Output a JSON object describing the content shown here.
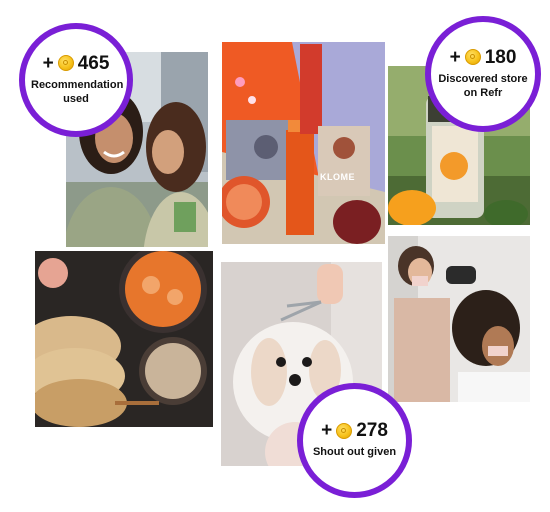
{
  "badges": [
    {
      "sign": "+",
      "points": "465",
      "caption": "Recommendation used"
    },
    {
      "sign": "+",
      "points": "180",
      "caption": "Discovered store on Refr"
    },
    {
      "sign": "+",
      "points": "278",
      "caption": "Shout out given"
    }
  ],
  "tiles": [
    {
      "subject": "friends-shopping-photo"
    },
    {
      "subject": "klome-skincare-products-photo",
      "brand_text": "KLOME"
    },
    {
      "subject": "tea-jar-oranges-photo"
    },
    {
      "subject": "curry-naan-rice-photo"
    },
    {
      "subject": "dog-grooming-photo"
    },
    {
      "subject": "hair-salon-photo"
    }
  ],
  "colors": {
    "badge_ring": "#7a1fd6",
    "coin": "#f7c21c"
  }
}
